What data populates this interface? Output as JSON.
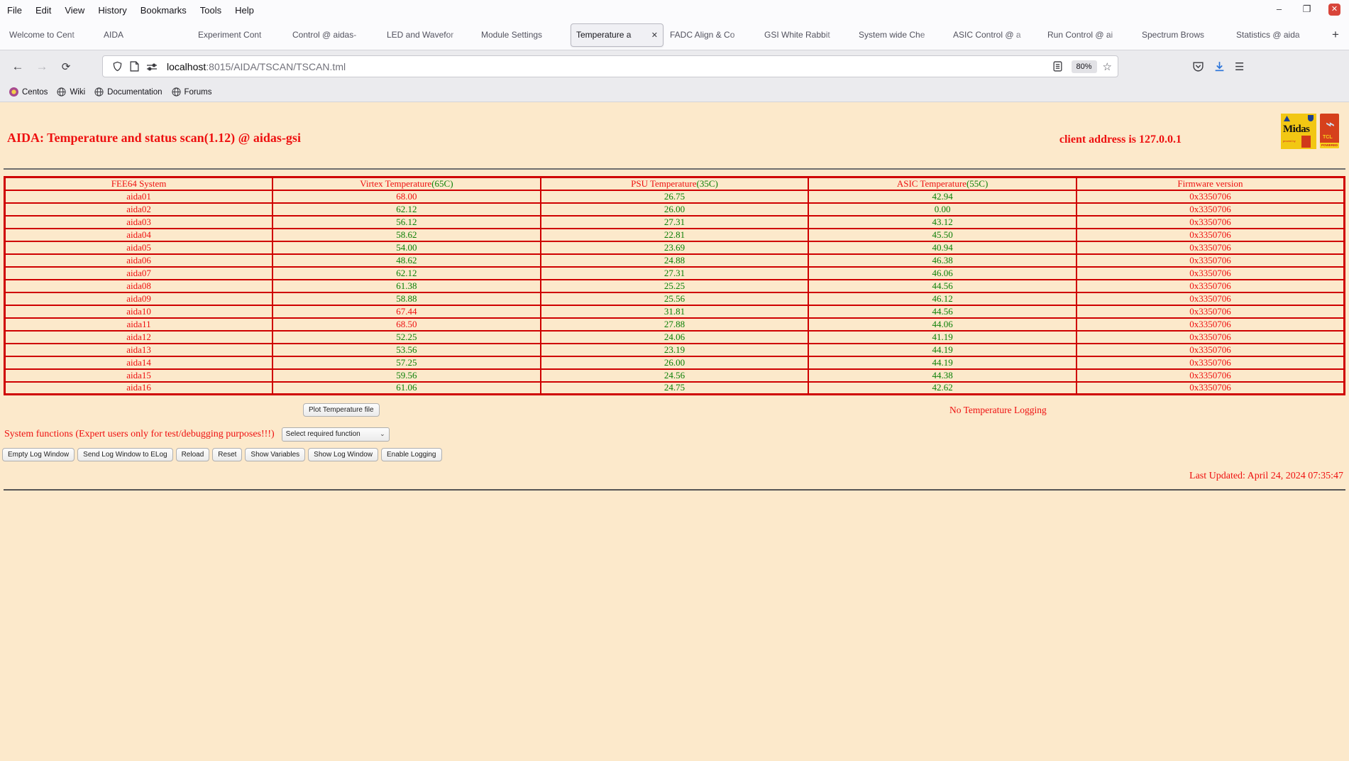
{
  "browser": {
    "menu": [
      "File",
      "Edit",
      "View",
      "History",
      "Bookmarks",
      "Tools",
      "Help"
    ],
    "window_icons": {
      "minimize": "–",
      "maximize": "❐",
      "close": "✕"
    },
    "tabs": [
      {
        "label": "Welcome to Cent",
        "active": false
      },
      {
        "label": "AIDA",
        "active": false
      },
      {
        "label": "Experiment Cont",
        "active": false
      },
      {
        "label": "Control @ aidas-",
        "active": false
      },
      {
        "label": "LED and Wavefor",
        "active": false
      },
      {
        "label": "Module Settings",
        "active": false
      },
      {
        "label": "Temperature a",
        "active": true
      },
      {
        "label": "FADC Align & Co",
        "active": false
      },
      {
        "label": "GSI White Rabbit",
        "active": false
      },
      {
        "label": "System wide Che",
        "active": false
      },
      {
        "label": "ASIC Control @ a",
        "active": false
      },
      {
        "label": "Run Control @ ai",
        "active": false
      },
      {
        "label": "Spectrum Brows",
        "active": false
      },
      {
        "label": "Statistics @ aida",
        "active": false
      }
    ],
    "icons": {
      "tab_close": "✕",
      "new_tab": "+",
      "back": "←",
      "forward": "→",
      "reload": "⟳",
      "star": "☆",
      "hamburger": "☰",
      "select_chevron": "⌄"
    },
    "url_host": "localhost",
    "url_rest": ":8015/AIDA/TSCAN/TSCAN.tml",
    "zoom_level": "80%",
    "bookmarks": [
      "Centos",
      "Wiki",
      "Documentation",
      "Forums"
    ]
  },
  "page": {
    "title": "AIDA: Temperature and status scan(1.12) @ aidas-gsi",
    "client_address": "client address is 127.0.0.1",
    "logos": {
      "midas_label": "Midas",
      "midas_sub": "proved by",
      "tcl_label": "TCL",
      "tcl_powered": "POWERED"
    },
    "table": {
      "columns": [
        {
          "name": "FEE64 System",
          "threshold": ""
        },
        {
          "name": "Virtex Temperature",
          "threshold": "(65C)"
        },
        {
          "name": "PSU Temperature",
          "threshold": "(35C)"
        },
        {
          "name": "ASIC Temperature",
          "threshold": "(55C)"
        },
        {
          "name": "Firmware version",
          "threshold": ""
        }
      ],
      "rows": [
        {
          "system": "aida01",
          "virtex": "68.00",
          "virtex_alarm": true,
          "psu": "26.75",
          "asic": "42.94",
          "firmware": "0x3350706"
        },
        {
          "system": "aida02",
          "virtex": "62.12",
          "virtex_alarm": false,
          "psu": "26.00",
          "asic": "0.00",
          "firmware": "0x3350706"
        },
        {
          "system": "aida03",
          "virtex": "56.12",
          "virtex_alarm": false,
          "psu": "27.31",
          "asic": "43.12",
          "firmware": "0x3350706"
        },
        {
          "system": "aida04",
          "virtex": "58.62",
          "virtex_alarm": false,
          "psu": "22.81",
          "asic": "45.50",
          "firmware": "0x3350706"
        },
        {
          "system": "aida05",
          "virtex": "54.00",
          "virtex_alarm": false,
          "psu": "23.69",
          "asic": "40.94",
          "firmware": "0x3350706"
        },
        {
          "system": "aida06",
          "virtex": "48.62",
          "virtex_alarm": false,
          "psu": "24.88",
          "asic": "46.38",
          "firmware": "0x3350706"
        },
        {
          "system": "aida07",
          "virtex": "62.12",
          "virtex_alarm": false,
          "psu": "27.31",
          "asic": "46.06",
          "firmware": "0x3350706"
        },
        {
          "system": "aida08",
          "virtex": "61.38",
          "virtex_alarm": false,
          "psu": "25.25",
          "asic": "44.56",
          "firmware": "0x3350706"
        },
        {
          "system": "aida09",
          "virtex": "58.88",
          "virtex_alarm": false,
          "psu": "25.56",
          "asic": "46.12",
          "firmware": "0x3350706"
        },
        {
          "system": "aida10",
          "virtex": "67.44",
          "virtex_alarm": true,
          "psu": "31.81",
          "asic": "44.56",
          "firmware": "0x3350706"
        },
        {
          "system": "aida11",
          "virtex": "68.50",
          "virtex_alarm": true,
          "psu": "27.88",
          "asic": "44.06",
          "firmware": "0x3350706"
        },
        {
          "system": "aida12",
          "virtex": "52.25",
          "virtex_alarm": false,
          "psu": "24.06",
          "asic": "41.19",
          "firmware": "0x3350706"
        },
        {
          "system": "aida13",
          "virtex": "53.56",
          "virtex_alarm": false,
          "psu": "23.19",
          "asic": "44.19",
          "firmware": "0x3350706"
        },
        {
          "system": "aida14",
          "virtex": "57.25",
          "virtex_alarm": false,
          "psu": "26.00",
          "asic": "44.19",
          "firmware": "0x3350706"
        },
        {
          "system": "aida15",
          "virtex": "59.56",
          "virtex_alarm": false,
          "psu": "24.56",
          "asic": "44.38",
          "firmware": "0x3350706"
        },
        {
          "system": "aida16",
          "virtex": "61.06",
          "virtex_alarm": false,
          "psu": "24.75",
          "asic": "42.62",
          "firmware": "0x3350706"
        }
      ]
    },
    "plot_button": "Plot Temperature file",
    "no_logging": "No Temperature Logging",
    "system_functions_label": "System functions (Expert users only for test/debugging purposes!!!)",
    "select_placeholder": "Select required function",
    "log_buttons": [
      "Empty Log Window",
      "Send Log Window to ELog",
      "Reload",
      "Reset",
      "Show Variables",
      "Show Log Window",
      "Enable Logging"
    ],
    "last_updated": "Last Updated: April 24, 2024 07:35:47"
  }
}
